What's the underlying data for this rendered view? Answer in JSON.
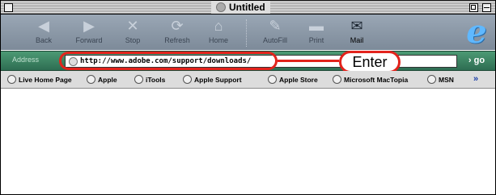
{
  "window": {
    "title": "Untitled"
  },
  "toolbar": {
    "buttons": [
      {
        "label": "Back",
        "icon": "back-arrow-icon"
      },
      {
        "label": "Forward",
        "icon": "forward-arrow-icon"
      },
      {
        "label": "Stop",
        "icon": "stop-icon"
      },
      {
        "label": "Refresh",
        "icon": "refresh-icon"
      },
      {
        "label": "Home",
        "icon": "home-icon"
      },
      {
        "label": "AutoFill",
        "icon": "autofill-icon"
      },
      {
        "label": "Print",
        "icon": "print-icon"
      },
      {
        "label": "Mail",
        "icon": "mail-icon"
      }
    ]
  },
  "address": {
    "label": "Address",
    "value": "http://www.adobe.com/support/downloads/",
    "go_label": "› go"
  },
  "annotation": {
    "enter_label": "Enter",
    "color": "#e3231c"
  },
  "favorites": [
    "Live Home Page",
    "Apple",
    "iTools",
    "Apple Support",
    "Apple Store",
    "Microsoft MacTopia",
    "MSN"
  ],
  "favorites_more": "»",
  "colors": {
    "toolbar": "#8a96a5",
    "address_bar": "#3f8563",
    "accent": "#e3231c"
  }
}
